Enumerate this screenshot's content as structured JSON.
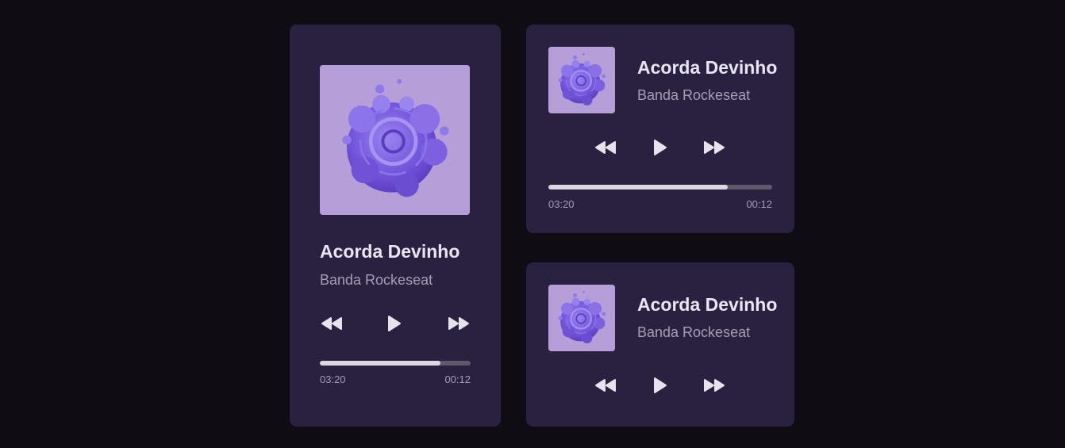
{
  "colors": {
    "background": "#0f0d13",
    "card": "#2a2141",
    "title": "#e9e5f2",
    "artist": "#a59eb4",
    "track": "#5f596b",
    "track_fill": "#dcd8e3",
    "album_bg": "#b49ad6",
    "album_art": "#7b5ce0"
  },
  "players": [
    {
      "title": "Acorda Devinho",
      "artist": "Banda Rockeseat",
      "icons": [
        "album-art-image",
        "rewind-icon",
        "play-icon",
        "fast-forward-icon"
      ],
      "progress": 0.8,
      "elapsed": "03:20",
      "remaining": "00:12"
    },
    {
      "title": "Acorda Devinho",
      "artist": "Banda Rockeseat",
      "icons": [
        "album-art-image",
        "rewind-icon",
        "play-icon",
        "fast-forward-icon"
      ],
      "progress": 0.8,
      "elapsed": "03:20",
      "remaining": "00:12"
    },
    {
      "title": "Acorda Devinho",
      "artist": "Banda Rockeseat",
      "icons": [
        "album-art-image",
        "rewind-icon",
        "play-icon",
        "fast-forward-icon"
      ]
    }
  ]
}
